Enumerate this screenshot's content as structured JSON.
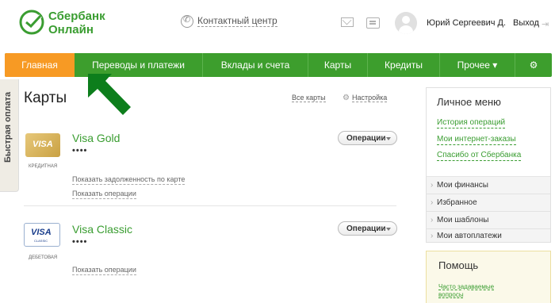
{
  "header": {
    "logo_line1": "Сбербанк",
    "logo_line2": "Онлайн",
    "contact_label": "Контактный центр",
    "user_name": "Юрий Сергеевич Д.",
    "logout_label": "Выход",
    "brand_color": "#3a9d31"
  },
  "nav": {
    "items": [
      {
        "label": "Главная",
        "active": true
      },
      {
        "label": "Переводы и платежи"
      },
      {
        "label": "Вклады и счета"
      },
      {
        "label": "Карты"
      },
      {
        "label": "Кредиты"
      },
      {
        "label": "Прочее ▾"
      },
      {
        "label": "⚙",
        "icon": "gear-icon"
      }
    ],
    "active_color": "#f79a24",
    "bg_color": "#3d9e2d"
  },
  "quick_pay": {
    "label": "Быстрая оплата"
  },
  "main": {
    "title": "Карты",
    "all_cards_label": "Все карты",
    "settings_label": "Настройка",
    "operations_label": "Операции",
    "cards": [
      {
        "name": "Visa Gold",
        "number": "••••",
        "type_label": "КРЕДИТНАЯ",
        "logo_text": "VISA",
        "links": [
          "Показать задолженность по карте",
          "Показать операции"
        ]
      },
      {
        "name": "Visa Classic",
        "number": "••••",
        "type_label": "ДЕБЕТОВАЯ",
        "logo_text": "VISA",
        "logo_sub": "CLASSIC",
        "links": [
          "Показать операции"
        ]
      }
    ]
  },
  "sidebar": {
    "menu_title": "Личное меню",
    "links": [
      "История операций",
      "Мои интернет-заказы",
      "Спасибо от Сбербанка"
    ],
    "items": [
      "Мои финансы",
      "Избранное",
      "Мои шаблоны",
      "Мои автоплатежи"
    ],
    "help_title": "Помощь",
    "help_link": "Часто задаваемые вопросы"
  }
}
